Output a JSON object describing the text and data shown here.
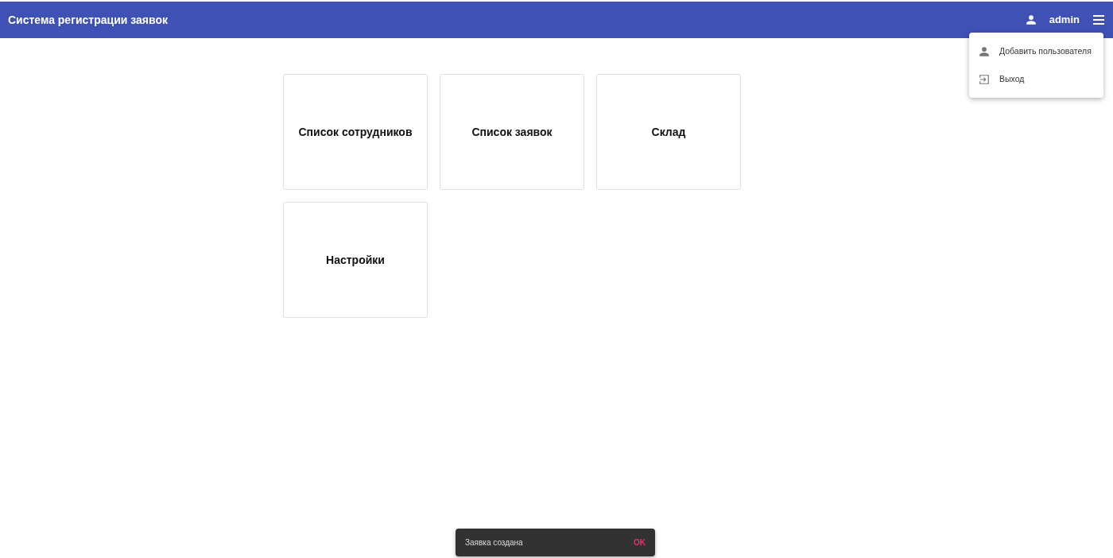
{
  "toolbar": {
    "title": "Система регистрации заявок",
    "user": "admin"
  },
  "menu": {
    "items": [
      {
        "kind": "user",
        "label": "Добавить пользователя"
      },
      {
        "kind": "logout",
        "label": "Выход"
      }
    ]
  },
  "tiles": [
    {
      "label": "Список сотрудников"
    },
    {
      "label": "Список заявок"
    },
    {
      "label": "Склад"
    },
    {
      "label": "Настройки"
    }
  ],
  "snackbar": {
    "message": "Заявка создана",
    "action": "OK"
  }
}
